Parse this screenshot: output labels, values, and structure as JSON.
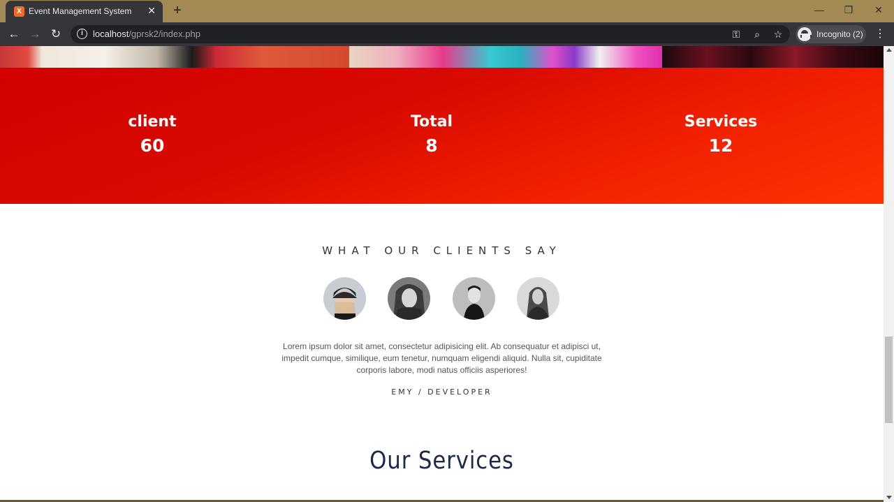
{
  "browser": {
    "tab_title": "Event Management System",
    "favicon_letter": "⌘",
    "url_host": "localhost",
    "url_path": "/gprsk2/index.php",
    "incognito_label": "Incognito (2)"
  },
  "counters": [
    {
      "label": "client",
      "value": "60"
    },
    {
      "label": "Total",
      "value": "8"
    },
    {
      "label": "Services",
      "value": "12"
    }
  ],
  "testimonials": {
    "heading": "WHAT OUR CLIENTS SAY",
    "quote": "Lorem ipsum dolor sit amet, consectetur adipisicing elit. Ab consequatur et adipisci ut, impedit cumque, similique, eum tenetur, numquam eligendi aliquid. Nulla sit, cupiditate corporis labore, modi natus officiis asperiores!",
    "author": "EMY / DEVELOPER"
  },
  "services": {
    "title": "Our Services"
  },
  "colors": {
    "accent_red": "#d90a00",
    "accent_orange": "#ff3300",
    "title_navy": "#1b2a4a",
    "chrome_titlebar": "#a38a55"
  }
}
